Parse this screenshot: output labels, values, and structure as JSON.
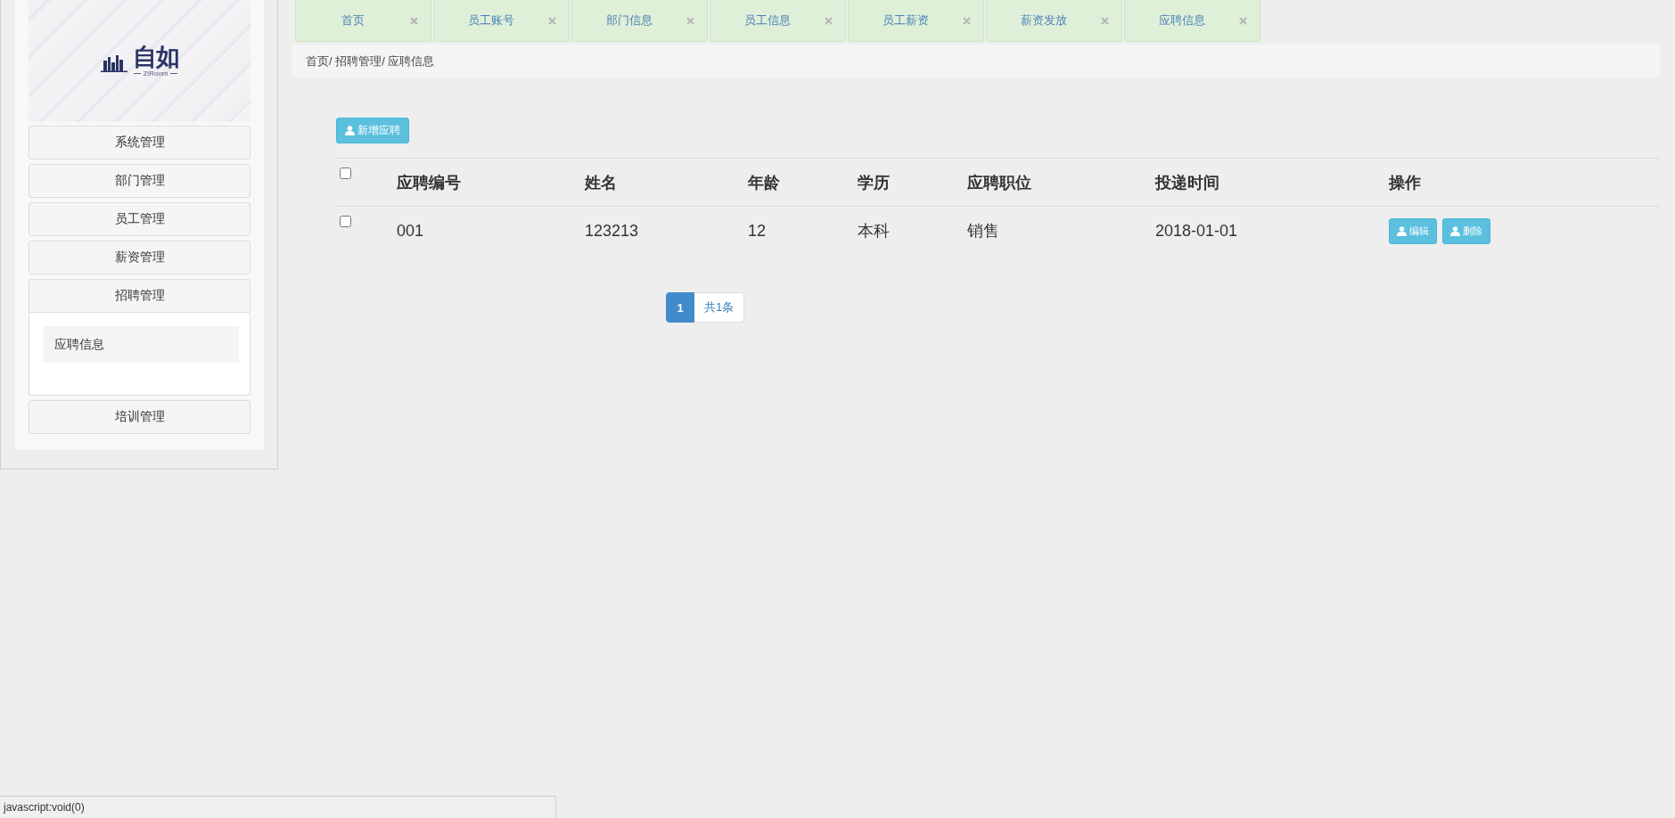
{
  "sidebar": {
    "logo": {
      "title": "自如",
      "subtitle": "ZiRoom"
    },
    "menu": [
      {
        "label": "系统管理",
        "expanded": false
      },
      {
        "label": "部门管理",
        "expanded": false
      },
      {
        "label": "员工管理",
        "expanded": false
      },
      {
        "label": "薪资管理",
        "expanded": false
      },
      {
        "label": "招聘管理",
        "expanded": true,
        "children": [
          {
            "label": "应聘信息"
          }
        ]
      },
      {
        "label": "培训管理",
        "expanded": false
      }
    ]
  },
  "tabs": [
    {
      "label": "首页"
    },
    {
      "label": "员工账号"
    },
    {
      "label": "部门信息"
    },
    {
      "label": "员工信息"
    },
    {
      "label": "员工薪资"
    },
    {
      "label": "薪资发放"
    },
    {
      "label": "应聘信息"
    }
  ],
  "breadcrumb": "首页/ 招聘管理/ 应聘信息",
  "toolbar": {
    "add_button": "新增应聘"
  },
  "table": {
    "select_all": {
      "checked": false
    },
    "columns": [
      "应聘编号",
      "姓名",
      "年龄",
      "学历",
      "应聘职位",
      "投递时间",
      "操作"
    ],
    "rows": [
      {
        "checked": false,
        "cells": [
          "001",
          "123213",
          "12",
          "本科",
          "销售",
          "2018-01-01"
        ],
        "actions": [
          "编辑",
          "删除"
        ]
      }
    ]
  },
  "pagination": {
    "pages": [
      {
        "label": "1",
        "selected": true
      }
    ],
    "summary": "共1条"
  },
  "status_bar": "javascript:void(0)"
}
